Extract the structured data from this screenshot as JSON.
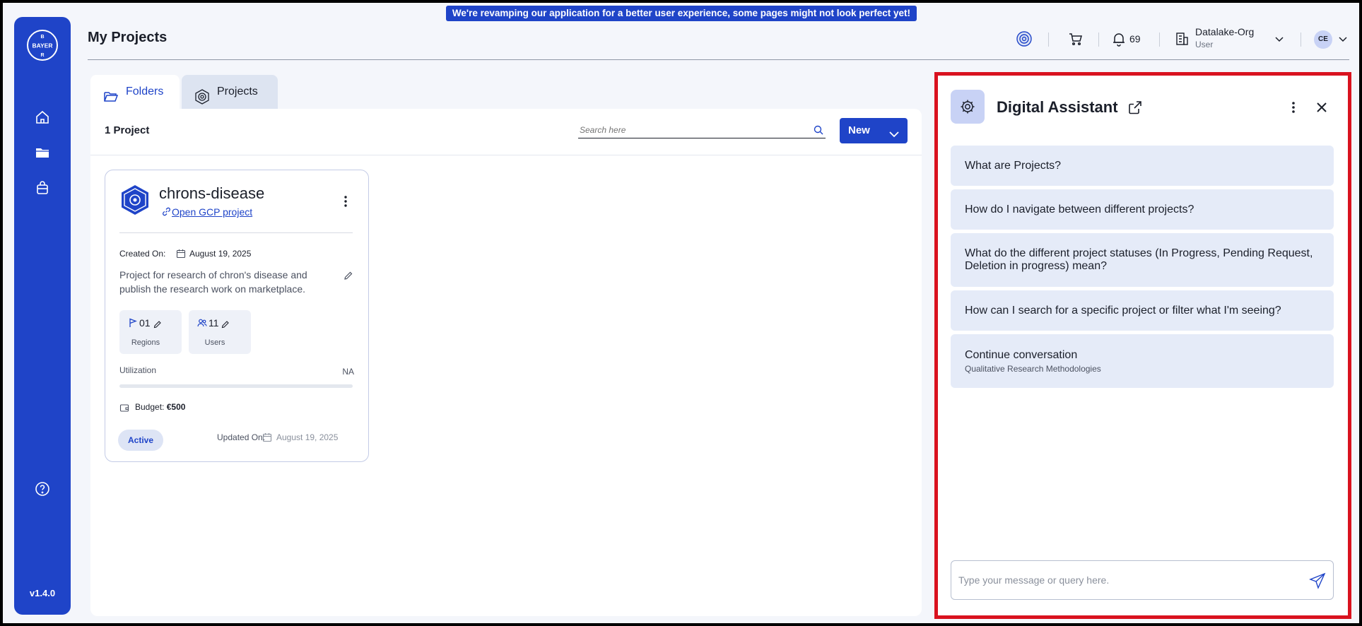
{
  "banner": {
    "text": "We're revamping our application for a better user experience, some pages might not look perfect yet!"
  },
  "sidebar": {
    "logo_text": "BAYER",
    "items": [
      {
        "icon": "home-icon"
      },
      {
        "icon": "folder-icon"
      },
      {
        "icon": "shopping-bag-icon"
      }
    ],
    "help_icon": "help-icon",
    "version": "v1.4.0"
  },
  "header": {
    "title": "My Projects",
    "notifications_count": "69",
    "org_name": "Datalake-Org",
    "org_role": "User",
    "avatar_initials": "CE"
  },
  "tabs": [
    {
      "label": "Folders",
      "active": true
    },
    {
      "label": "Projects",
      "active": false
    }
  ],
  "main": {
    "project_count": "1 Project",
    "search_placeholder": "Search here",
    "new_button": "New"
  },
  "project": {
    "name": "chrons-disease",
    "link": "Open GCP project",
    "created_label": "Created On:",
    "created_date": "August 19, 2025",
    "description": "Project for research of chron's disease and publish the research work on marketplace.",
    "regions_value": "01",
    "regions_label": "Regions",
    "users_value": "11",
    "users_label": "Users",
    "utilization_label": "Utilization",
    "utilization_value": "NA",
    "budget_label": "Budget:",
    "budget_value": "€500",
    "status": "Active",
    "updated_label": "Updated On:",
    "updated_date": "August 19, 2025"
  },
  "assistant": {
    "title": "Digital Assistant",
    "suggestions": [
      {
        "text": "What are Projects?"
      },
      {
        "text": "How do I navigate between different projects?"
      },
      {
        "text": "What do the different project statuses (In Progress, Pending Request, Deletion in progress) mean?"
      },
      {
        "text": "How can I search for a specific project or filter what I'm seeing?"
      },
      {
        "text": "Continue conversation",
        "sub": "Qualitative Research Methodologies"
      }
    ],
    "input_placeholder": "Type your message or query here."
  },
  "colors": {
    "brand": "#1f44c8",
    "highlight_border": "#d9121f",
    "suggestion_bg": "#e5ebf8"
  }
}
